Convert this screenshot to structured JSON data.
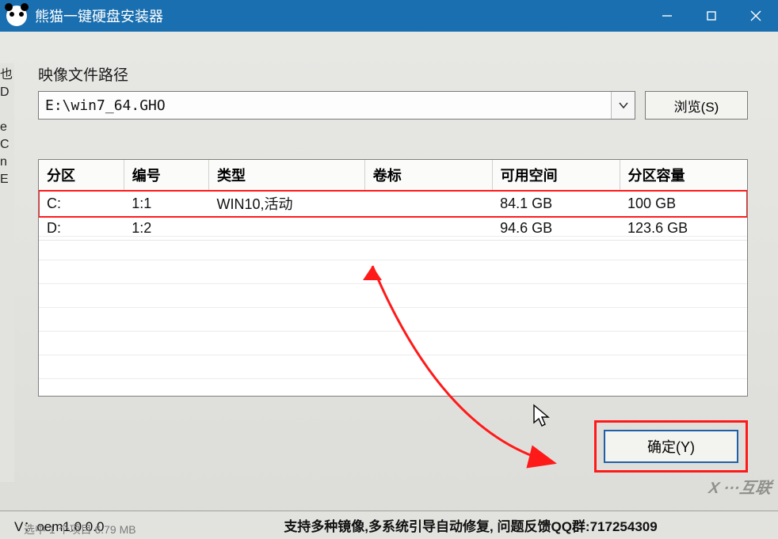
{
  "window": {
    "title": "熊猫一键硬盘安装器"
  },
  "image_path": {
    "label": "映像文件路径",
    "value": "E:\\win7_64.GHO",
    "browse_label": "浏览(S)"
  },
  "table": {
    "headers": {
      "partition": "分区",
      "number": "编号",
      "type": "类型",
      "label": "卷标",
      "free": "可用空间",
      "size": "分区容量"
    },
    "rows": [
      {
        "partition": "C:",
        "number": "1:1",
        "type": "WIN10,活动",
        "label": "",
        "free": "84.1 GB",
        "size": "100 GB",
        "highlighted": true
      },
      {
        "partition": "D:",
        "number": "1:2",
        "type": "",
        "label": "",
        "free": "94.6 GB",
        "size": "123.6 GB",
        "highlighted": false
      }
    ]
  },
  "confirm_label": "确定(Y)",
  "status": {
    "version": "V：oem1.0.0.0",
    "message": "支持多种镜像,多系统引导自动修复, 问题反馈QQ群:717254309"
  },
  "annotation_colors": {
    "highlight": "#ff1a1a"
  },
  "bottom_ghost": "选中 1 个项目  6.79 MB"
}
